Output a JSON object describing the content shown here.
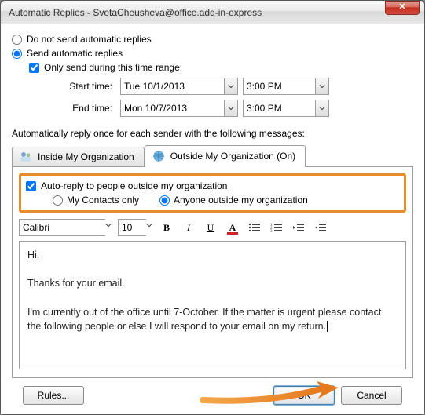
{
  "titlebar": {
    "text": "Automatic Replies - SvetaCheusheva@office.add-in-express",
    "close_glyph": "✕"
  },
  "options": {
    "no_send_label": "Do not send automatic replies",
    "send_label": "Send automatic replies",
    "selected": "send",
    "only_range_label": "Only send during this time range:",
    "only_range_checked": true,
    "start_label": "Start time:",
    "end_label": "End time:",
    "start_date": "Tue 10/1/2013",
    "start_time": "3:00 PM",
    "end_date": "Mon 10/7/2013",
    "end_time": "3:00 PM"
  },
  "section_label": "Automatically reply once for each sender with the following messages:",
  "tabs": {
    "inside_label": "Inside My Organization",
    "outside_label": "Outside My Organization (On)",
    "active": "outside"
  },
  "outside": {
    "auto_reply_label": "Auto-reply to people outside my organization",
    "auto_reply_checked": true,
    "contacts_only_label": "My Contacts only",
    "anyone_label": "Anyone outside my organization",
    "scope_selected": "anyone"
  },
  "toolbar": {
    "font": "Calibri",
    "size": "10"
  },
  "message": {
    "p1": "Hi,",
    "p2": "Thanks for your email.",
    "p3": "I'm currently out of the office until 7-October. If the matter is urgent please contact the following people or else I will respond to your email on my return."
  },
  "footer": {
    "rules_label": "Rules...",
    "ok_label": "OK",
    "cancel_label": "Cancel"
  }
}
